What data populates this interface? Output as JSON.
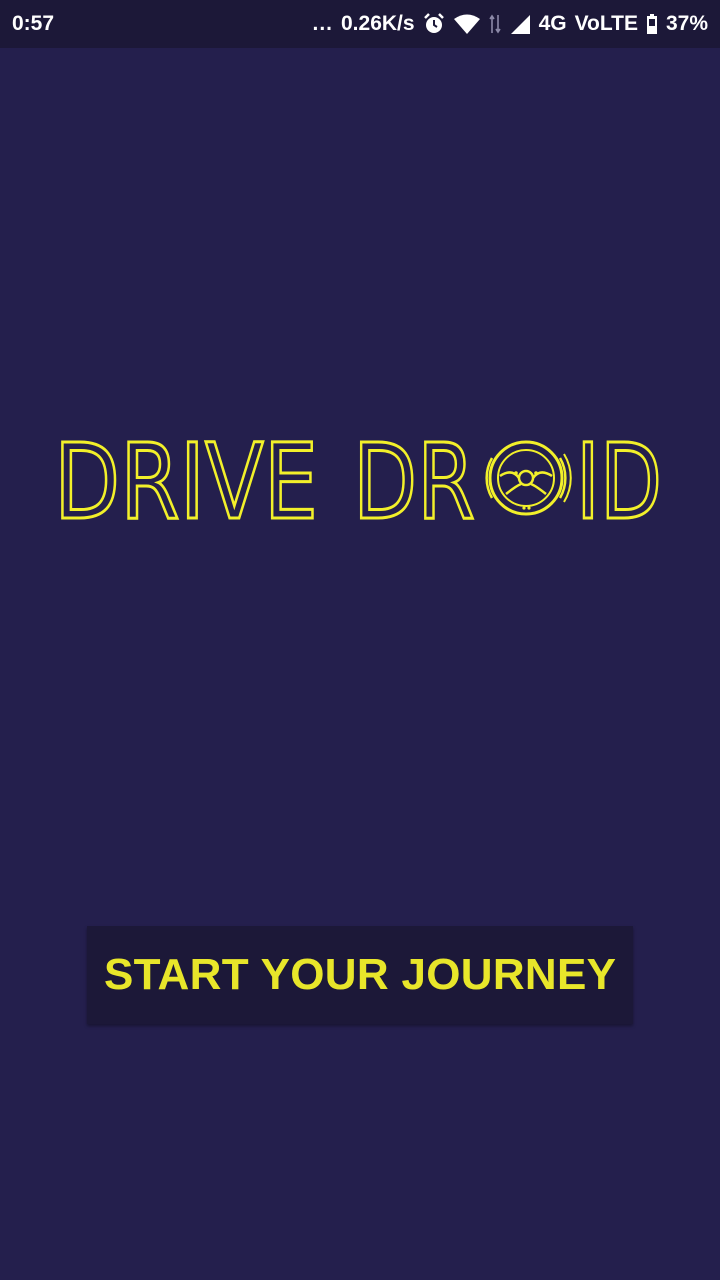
{
  "status_bar": {
    "time": "0:57",
    "dots": "...",
    "network_speed": "0.26K/s",
    "network_type": "4G",
    "volte": "VoLTE",
    "battery_percent": "37%",
    "icons": [
      "alarm-icon",
      "wifi-icon",
      "data-arrows-icon",
      "signal-icon",
      "battery-icon"
    ]
  },
  "logo": {
    "word1": "DRIVE",
    "word2_start": "DR",
    "word2_end": "ID",
    "wheel_icon": "steering-wheel-icon",
    "color": "#f2f02a"
  },
  "main": {
    "cta_label": "START YOUR JOURNEY"
  },
  "colors": {
    "background": "#241f4d",
    "status_bar": "#1c1838",
    "button_bg": "#1c1838",
    "accent": "#e8e62a"
  }
}
